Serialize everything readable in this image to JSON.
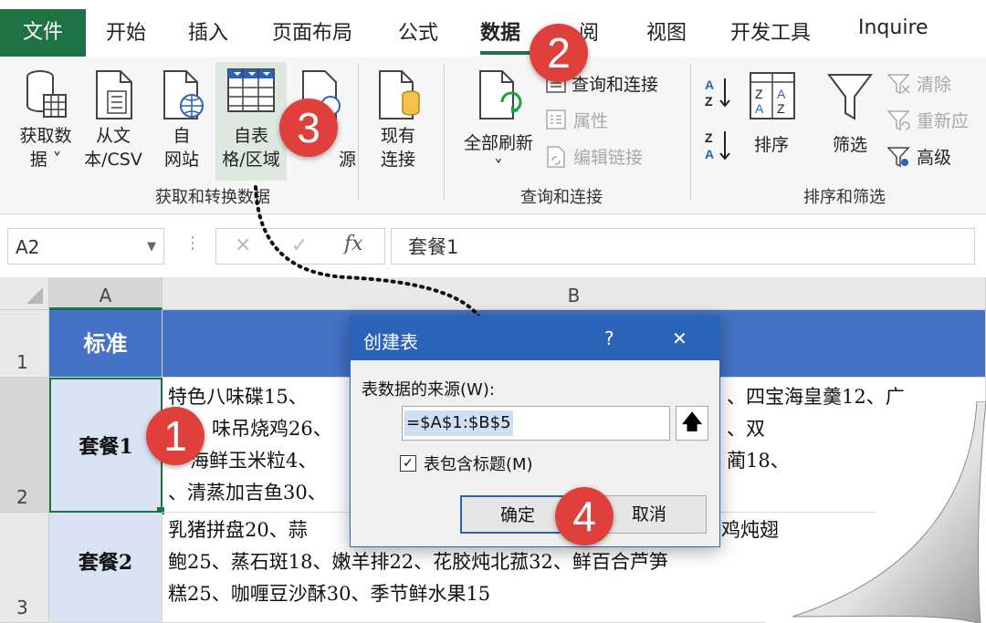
{
  "tabs": {
    "file": "文件",
    "home": "开始",
    "insert": "插入",
    "page_layout": "页面布局",
    "formulas": "公式",
    "data": "数据",
    "review": "阅",
    "view": "视图",
    "developer": "开发工具",
    "inquire": "Inquire"
  },
  "ribbon": {
    "get_data": [
      "获取数",
      "据 ˅"
    ],
    "from_csv": [
      "从文",
      "本/CSV"
    ],
    "from_web": [
      "自",
      "网站"
    ],
    "from_table": [
      "自表",
      "格/区域"
    ],
    "recent_sources": [
      "",
      "源"
    ],
    "existing_connections": [
      "现有",
      "连接"
    ],
    "group_get_transform": "获取和转换数据",
    "refresh_all": [
      "全部刷新",
      "˅"
    ],
    "queries_connections": "查询和连接",
    "properties": "属性",
    "edit_links": "编辑链接",
    "group_queries": "查询和连接",
    "sort": "排序",
    "filter": "筛选",
    "clear": "清除",
    "reapply": "重新应",
    "advanced": "高级",
    "group_sort_filter": "排序和筛选"
  },
  "formula_bar": {
    "name_box": "A2",
    "cancel_glyph": "✕",
    "enter_glyph": "✓",
    "fx": "fx",
    "formula": "套餐1"
  },
  "sheet": {
    "columns": [
      "A",
      "B"
    ],
    "rows": [
      "1",
      "2",
      "3"
    ],
    "a1": "标准",
    "a2": "套餐1",
    "a3": "套餐2",
    "b2_lines": [
      "特色八味碟15、",
      "味吊烧鸡26、",
      "海鲜玉米粒4、",
      "、清蒸加吉鱼30、"
    ],
    "b2_right": [
      "、四宝海皇羹12、广",
      "、双",
      "蔺18、"
    ],
    "b3_lines": [
      "乳猪拼盘20、蒜",
      "鲍25、蒸石斑18、嫩羊排22、花胶炖北菰32、鲜百合芦笋",
      "糕25、咖喱豆沙酥30、季节鲜水果15"
    ],
    "b3_right": "鸡炖翅"
  },
  "dialog": {
    "title": "创建表",
    "help": "?",
    "close": "✕",
    "source_label": "表数据的来源(W):",
    "range": "=$A$1:$B$5",
    "has_headers": "表包含标题(M)",
    "ok": "确定",
    "cancel": "取消"
  },
  "badges": [
    "1",
    "2",
    "3",
    "4"
  ],
  "colors": {
    "excel_green": "#1f7244",
    "header_blue": "#4472c4",
    "badge_red": "#e0403c",
    "dialog_blue": "#2b63b8"
  }
}
